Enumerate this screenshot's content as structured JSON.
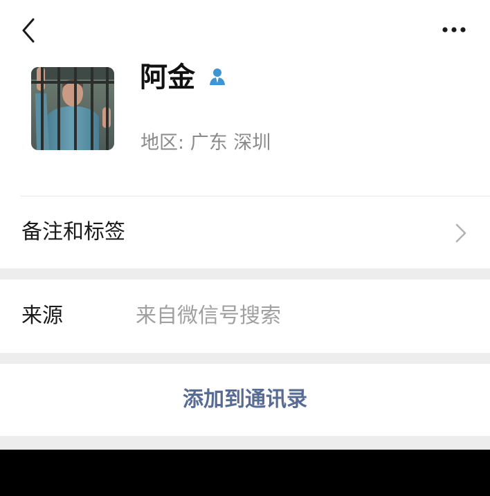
{
  "header": {
    "back_icon": "chevron-left-icon",
    "more_icon": "more-dots-icon"
  },
  "profile": {
    "name": "阿金",
    "verified_icon": "contact-person-icon",
    "region_label": "地区:",
    "region_value": "广东 深圳"
  },
  "remark": {
    "label": "备注和标签",
    "chevron_icon": "chevron-right-icon"
  },
  "source": {
    "label": "来源",
    "value": "来自微信号搜索"
  },
  "add_contact": {
    "label": "添加到通讯录"
  },
  "colors": {
    "background_gray": "#ededed",
    "card_white": "#ffffff",
    "link_blue": "#576b95",
    "verified_blue": "#3f95d4",
    "secondary_text": "#8a8a8a"
  }
}
